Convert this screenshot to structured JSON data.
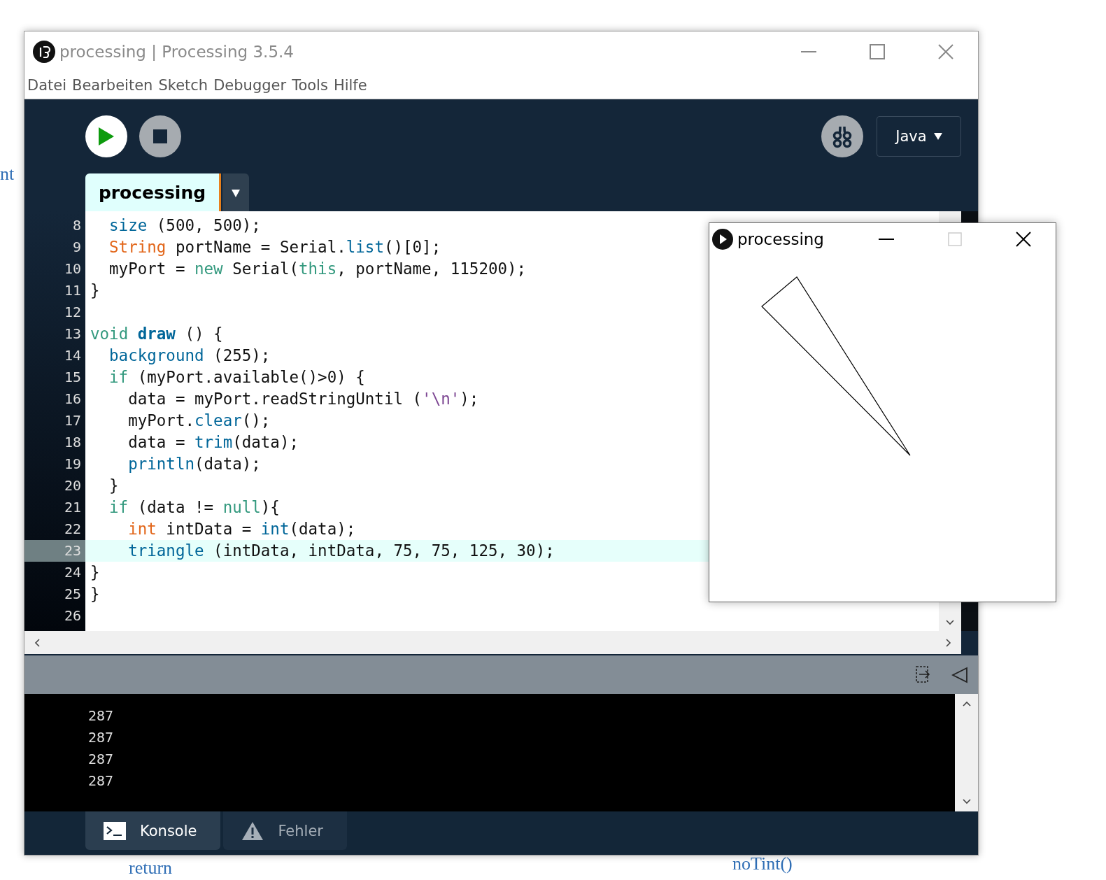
{
  "background_links": [
    "nt",
    "return",
    "noTint()"
  ],
  "window": {
    "title": "processing | Processing 3.5.4"
  },
  "menu": [
    "Datei",
    "Bearbeiten",
    "Sketch",
    "Debugger",
    "Tools",
    "Hilfe"
  ],
  "toolbar": {
    "mode": "Java"
  },
  "editor_tabs": [
    {
      "label": "processing",
      "selected": true
    }
  ],
  "code_lines": [
    {
      "children": [
        {
          "number": "8",
          "highlighted": false,
          "tokens": [
            {
              "text": "size",
              "kind": "function"
            },
            {
              "text": " (500, 500);"
            }
          ]
        },
        {
          "number": "9",
          "highlighted": false,
          "tokens": [
            {
              "text": "String",
              "kind": "type"
            },
            {
              "text": " portName = Serial."
            },
            {
              "text": "list",
              "kind": "function"
            },
            {
              "text": "()[0];"
            }
          ]
        },
        {
          "number": "10",
          "highlighted": false,
          "tokens": [
            {
              "text": "myPort = "
            },
            {
              "text": "new",
              "kind": "keyword"
            },
            {
              "text": " Serial("
            },
            {
              "text": "this",
              "kind": "keyword"
            },
            {
              "text": ", portName, 115200);"
            }
          ]
        }
      ]
    },
    {
      "number": "11",
      "highlighted": false,
      "tokens": [
        {
          "text": "}"
        }
      ]
    },
    {
      "number": "12",
      "highlighted": false
    },
    {
      "number": "13",
      "highlighted": false,
      "tokens": [
        {
          "text": "void ",
          "kind": "keyword"
        },
        {
          "text": "draw",
          "kind": "definition"
        },
        {
          "text": " () {"
        }
      ],
      "children": [
        {
          "number": "14",
          "highlighted": false,
          "tokens": [
            {
              "text": "background",
              "kind": "function"
            },
            {
              "text": " (255);"
            }
          ]
        },
        {
          "number": "15",
          "highlighted": false,
          "tokens": [
            {
              "text": "if",
              "kind": "keyword"
            },
            {
              "text": " (myPort.available()>0) {"
            }
          ],
          "children": [
            {
              "number": "16",
              "highlighted": false,
              "tokens": [
                {
                  "text": "data = myPort.readStringUntil ("
                },
                {
                  "text": "'\\n'",
                  "kind": "string"
                },
                {
                  "text": ");"
                }
              ]
            },
            {
              "number": "17",
              "highlighted": false,
              "tokens": [
                {
                  "text": "myPort."
                },
                {
                  "text": "clear",
                  "kind": "function"
                },
                {
                  "text": "();"
                }
              ]
            },
            {
              "number": "18",
              "highlighted": false,
              "tokens": [
                {
                  "text": "data = "
                },
                {
                  "text": "trim",
                  "kind": "function"
                },
                {
                  "text": "(data);"
                }
              ]
            },
            {
              "number": "19",
              "highlighted": false,
              "tokens": [
                {
                  "text": "println",
                  "kind": "function"
                },
                {
                  "text": "(data);"
                }
              ]
            }
          ]
        },
        {
          "number": "20",
          "highlighted": false,
          "tokens": [
            {
              "text": "}"
            }
          ]
        },
        {
          "number": "21",
          "highlighted": false,
          "tokens": [
            {
              "text": "if",
              "kind": "keyword"
            },
            {
              "text": " (data != "
            },
            {
              "text": "null",
              "kind": "keyword"
            },
            {
              "text": "){"
            }
          ],
          "children": [
            {
              "number": "22",
              "highlighted": false,
              "tokens": [
                {
                  "text": "int",
                  "kind": "type"
                },
                {
                  "text": " intData = "
                },
                {
                  "text": "int",
                  "kind": "function"
                },
                {
                  "text": "(data);"
                }
              ]
            },
            {
              "number": "23",
              "highlighted": true,
              "tokens": [
                {
                  "text": "triangle",
                  "kind": "function"
                },
                {
                  "text": " (intData, intData, 75, 75, 125, 30);"
                }
              ]
            }
          ]
        }
      ]
    },
    {
      "number": "24",
      "highlighted": false,
      "tokens": [
        {
          "text": "}"
        }
      ]
    },
    {
      "number": "25",
      "highlighted": false,
      "tokens": [
        {
          "text": "}"
        }
      ]
    },
    {
      "number": "26",
      "highlighted": false
    }
  ],
  "console_lines": [
    "287",
    "287",
    "287",
    "287"
  ],
  "console_tabs": [
    {
      "label": "Konsole",
      "kind": "console",
      "selected": true
    },
    {
      "label": "Fehler",
      "kind": "errors",
      "selected": false
    }
  ],
  "sketch_window": {
    "title": "processing"
  }
}
